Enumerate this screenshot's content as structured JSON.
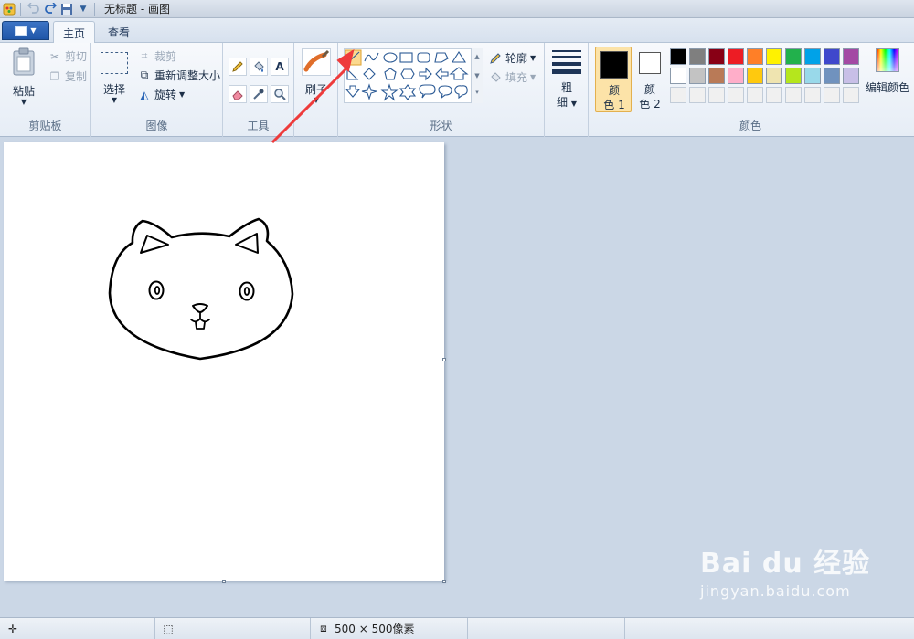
{
  "window": {
    "title": "无标题 - 画图"
  },
  "tabs": {
    "file_icon": "paint-menu-icon",
    "home": "主页",
    "view": "查看"
  },
  "clipboard": {
    "paste": "粘贴",
    "cut": "剪切",
    "copy": "复制",
    "label": "剪贴板"
  },
  "image": {
    "select": "选择",
    "crop": "裁剪",
    "resize": "重新调整大小",
    "rotate": "旋转",
    "label": "图像"
  },
  "tools": {
    "label": "工具",
    "text_tool": "A"
  },
  "brushes": {
    "label": "刷子"
  },
  "shapes": {
    "label": "形状",
    "outline": "轮廓",
    "fill": "填充"
  },
  "size": {
    "label_line1": "粗",
    "label_line2": "细"
  },
  "colors": {
    "color1_line1": "颜",
    "color1_line2": "色 1",
    "color2_line1": "颜",
    "color2_line2": "色 2",
    "edit": "编辑颜色",
    "label": "颜色",
    "color1_value": "#000000",
    "color2_value": "#ffffff",
    "palette_row1": [
      "#000000",
      "#7f7f7f",
      "#880015",
      "#ed1c24",
      "#ff7f27",
      "#fff200",
      "#22b14c",
      "#00a2e8",
      "#3f48cc",
      "#a349a4"
    ],
    "palette_row2": [
      "#ffffff",
      "#c3c3c3",
      "#b97a57",
      "#ffaec9",
      "#ffc90e",
      "#efe4b0",
      "#b5e61d",
      "#99d9ea",
      "#7092be",
      "#c8bfe7"
    ],
    "palette_row3": [
      "#f0f0f0",
      "#f0f0f0",
      "#f0f0f0",
      "#f0f0f0",
      "#f0f0f0",
      "#f0f0f0",
      "#f0f0f0",
      "#f0f0f0",
      "#f0f0f0",
      "#f0f0f0"
    ]
  },
  "status": {
    "canvas_size": "500 × 500像素"
  },
  "watermark": {
    "title": "Bai du 经验",
    "sub": "jingyan.baidu.com"
  },
  "accent": {
    "annotation_arrow": "#ee3b3b",
    "selection": "#fbd98f"
  }
}
